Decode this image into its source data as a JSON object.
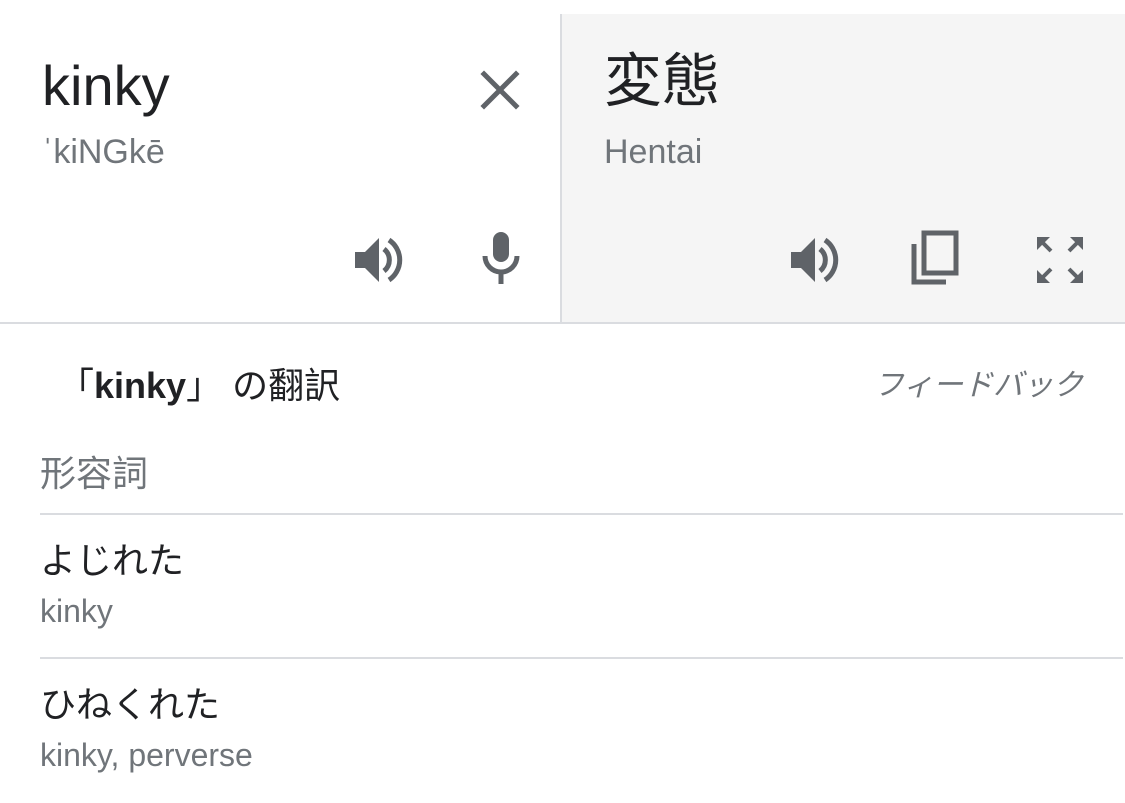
{
  "source": {
    "text": "kinky",
    "transliteration": "ˈkiNGkē",
    "icons": {
      "clear": "close-icon",
      "listen": "speaker-icon",
      "voice": "microphone-icon"
    }
  },
  "target": {
    "text": "変態",
    "transliteration": "Hentai",
    "icons": {
      "listen": "speaker-icon",
      "copy": "copy-icon",
      "expand": "fullscreen-icon"
    }
  },
  "translations_section": {
    "heading_open": "「",
    "heading_term": "kinky",
    "heading_close": "」",
    "heading_suffix": " の翻訳",
    "feedback_label": "フィードバック",
    "part_of_speech": "形容詞",
    "entries": [
      {
        "term": "よじれた",
        "synonyms": "kinky"
      },
      {
        "term": "ひねくれた",
        "synonyms": "kinky, perverse"
      }
    ]
  },
  "colors": {
    "text_primary": "#202124",
    "text_secondary": "#70757a",
    "icon": "#5f6368",
    "divider": "#dadce0",
    "target_background": "#f5f5f5"
  }
}
